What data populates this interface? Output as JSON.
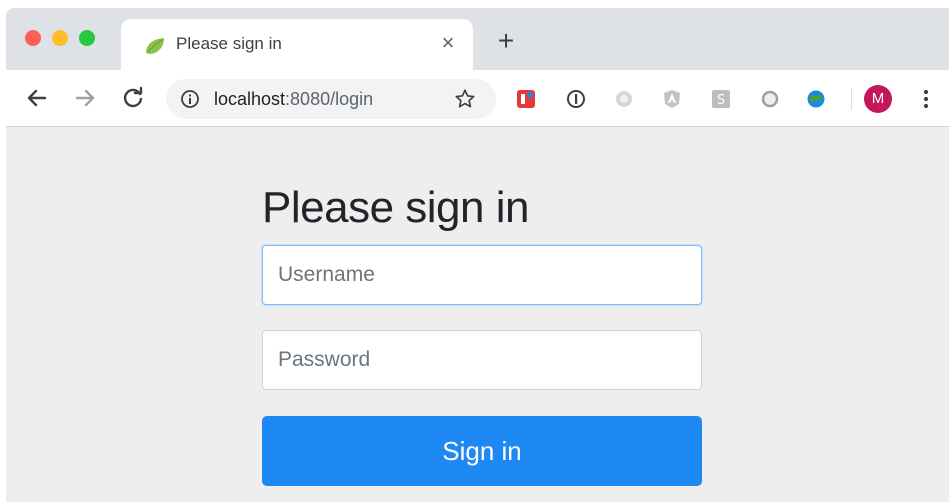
{
  "browser": {
    "tab": {
      "title": "Please sign in",
      "favicon": "spring-leaf-icon",
      "close_label": "×"
    },
    "new_tab_label": "+",
    "address": {
      "host": "localhost",
      "path": ":8080/login"
    },
    "extensions": [
      "red-extension-icon",
      "onepassword-icon",
      "circle-extension-icon",
      "angular-icon",
      "s-extension-icon",
      "gray-circle-icon",
      "globe-icon"
    ],
    "profile_initial": "M"
  },
  "login": {
    "heading": "Please sign in",
    "username_placeholder": "Username",
    "password_placeholder": "Password",
    "submit_label": "Sign in"
  },
  "colors": {
    "primary_button": "#1e88f5",
    "focus_border": "#80bdff",
    "avatar": "#c2185b"
  }
}
